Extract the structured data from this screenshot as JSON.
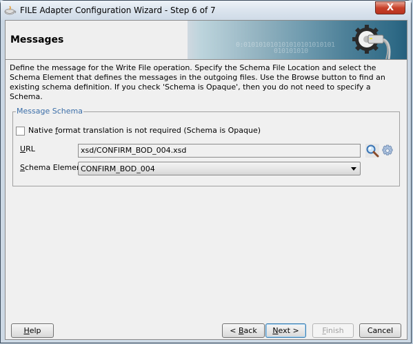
{
  "window": {
    "title": "FILE Adapter Configuration Wizard - Step 6 of 7",
    "close_label": "X"
  },
  "header": {
    "title": "Messages",
    "banner_binary_1": "0:010101010101010101010101",
    "banner_binary_2": "010101010"
  },
  "description": "Define the message for the Write File operation.  Specify the Schema File Location and select the Schema Element that defines the messages in the outgoing files. Use the Browse button to find an existing schema definition. If you check 'Schema is Opaque', then you do not need to specify a Schema.",
  "message_schema": {
    "legend": "Message Schema",
    "opaque_checkbox": {
      "label_pre": "Native ",
      "label_mnemonic": "f",
      "label_post": "ormat translation is not required (Schema is Opaque)",
      "checked": false
    },
    "url": {
      "label_mnemonic": "U",
      "label_rest": "RL",
      "value": "xsd/CONFIRM_BOD_004.xsd"
    },
    "schema_element": {
      "label_mnemonic": "S",
      "label_rest": "chema Element",
      "selected": "CONFIRM_BOD_004"
    }
  },
  "buttons": {
    "help": {
      "mnemonic": "H",
      "rest": "elp"
    },
    "back": {
      "pre": "< ",
      "mnemonic": "B",
      "rest": "ack"
    },
    "next": {
      "mnemonic": "N",
      "rest": "ext >"
    },
    "finish": {
      "mnemonic": "F",
      "rest": "inish",
      "enabled": false
    },
    "cancel": {
      "label": "Cancel"
    }
  }
}
